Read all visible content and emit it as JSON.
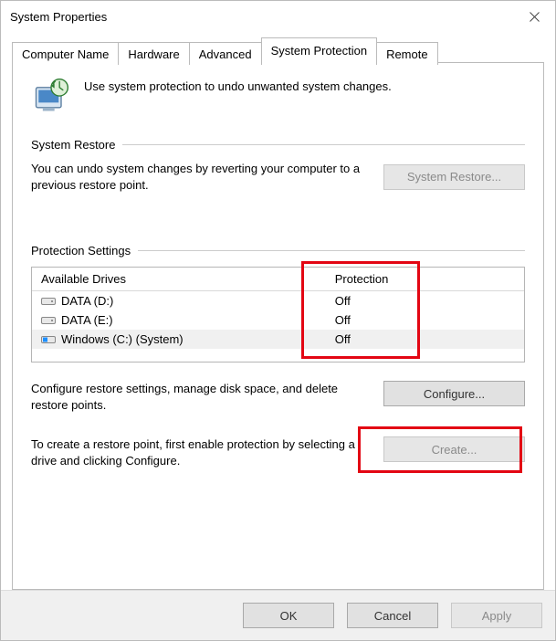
{
  "window": {
    "title": "System Properties"
  },
  "tabs": {
    "computer_name": "Computer Name",
    "hardware": "Hardware",
    "advanced": "Advanced",
    "system_protection": "System Protection",
    "remote": "Remote"
  },
  "intro": {
    "text": "Use system protection to undo unwanted system changes."
  },
  "restore": {
    "group": "System Restore",
    "text": "You can undo system changes by reverting your computer to a previous restore point.",
    "button": "System Restore..."
  },
  "protection": {
    "group": "Protection Settings",
    "head_drives": "Available Drives",
    "head_status": "Protection",
    "rows": [
      {
        "label": "DATA (D:)",
        "status": "Off"
      },
      {
        "label": "DATA (E:)",
        "status": "Off"
      },
      {
        "label": "Windows (C:) (System)",
        "status": "Off"
      }
    ],
    "configure_text": "Configure restore settings, manage disk space, and delete restore points.",
    "configure_button": "Configure...",
    "create_text": "To create a restore point, first enable protection by selecting a drive and clicking Configure.",
    "create_button": "Create..."
  },
  "footer": {
    "ok": "OK",
    "cancel": "Cancel",
    "apply": "Apply"
  }
}
